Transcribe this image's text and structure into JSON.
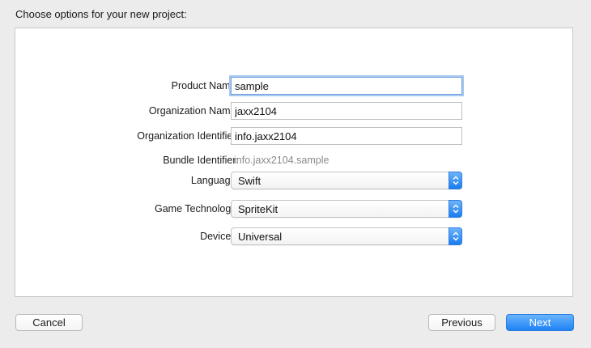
{
  "sheet": {
    "title": "Choose options for your new project:"
  },
  "form": {
    "product_name": {
      "label": "Product Name:",
      "value": "sample"
    },
    "organization_name": {
      "label": "Organization Name:",
      "value": "jaxx2104"
    },
    "organization_identifier": {
      "label": "Organization Identifier:",
      "value": "info.jaxx2104"
    },
    "bundle_identifier": {
      "label": "Bundle Identifier:",
      "value": "info.jaxx2104.sample"
    },
    "language": {
      "label": "Language:",
      "value": "Swift"
    },
    "game_technology": {
      "label": "Game Technology:",
      "value": "SpriteKit"
    },
    "devices": {
      "label": "Devices:",
      "value": "Universal"
    }
  },
  "buttons": {
    "cancel": "Cancel",
    "previous": "Previous",
    "next": "Next"
  },
  "icons": {
    "popup_arrows": "up-down-chevron-icon"
  },
  "colors": {
    "accent": "#1f82f5",
    "focus_ring": "#a9c8f0",
    "window_bg": "#ececec",
    "panel_bg": "#ffffff"
  }
}
